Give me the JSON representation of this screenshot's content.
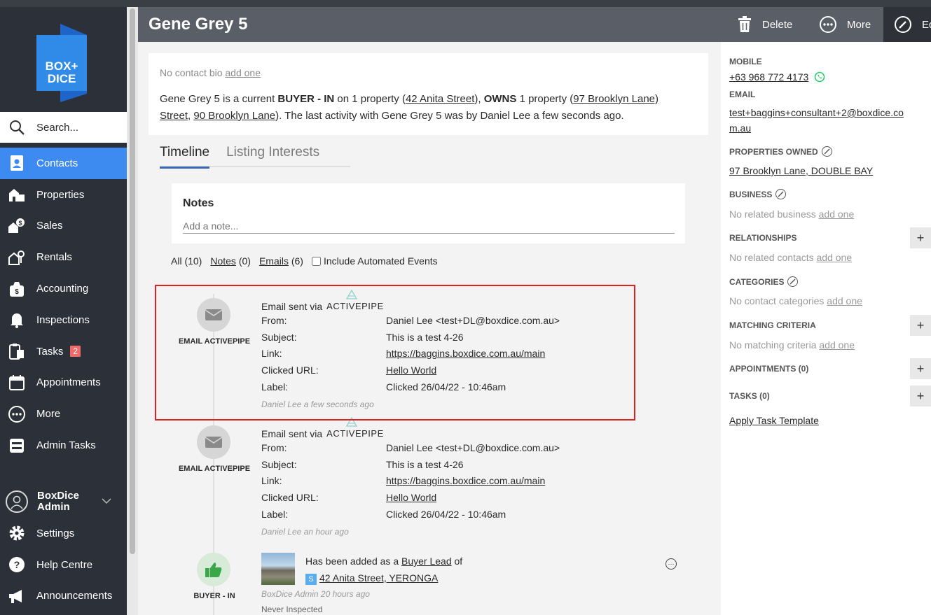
{
  "app": {
    "logo_text": "BOX+DICE"
  },
  "search": {
    "label": "Search..."
  },
  "nav": {
    "items": [
      {
        "label": "Contacts",
        "icon": "contacts-icon",
        "active": true
      },
      {
        "label": "Properties",
        "icon": "properties-icon"
      },
      {
        "label": "Sales",
        "icon": "sales-icon"
      },
      {
        "label": "Rentals",
        "icon": "rentals-icon"
      },
      {
        "label": "Accounting",
        "icon": "accounting-icon"
      },
      {
        "label": "Inspections",
        "icon": "bell-icon"
      },
      {
        "label": "Tasks",
        "icon": "tasks-icon",
        "badge": "2"
      },
      {
        "label": "Appointments",
        "icon": "calendar-icon"
      },
      {
        "label": "More",
        "icon": "more-icon"
      },
      {
        "label": "Admin Tasks",
        "icon": "admin-tasks-icon"
      }
    ],
    "user": {
      "name": "BoxDice Admin"
    },
    "bottom": [
      {
        "label": "Settings",
        "icon": "gear-icon"
      },
      {
        "label": "Help Centre",
        "icon": "help-icon"
      },
      {
        "label": "Announcements",
        "icon": "megaphone-icon"
      }
    ]
  },
  "header": {
    "title": "Gene Grey 5",
    "delete_label": "Delete",
    "more_label": "More",
    "edit_label": "Edit"
  },
  "bio": {
    "none_text": "No contact bio",
    "add_one": "add one",
    "summary": {
      "p1": "Gene Grey 5 is a current ",
      "buyer_status": "BUYER - IN",
      "p2": " on 1 property (",
      "buyer_prop": "42 Anita Street",
      "p3": "), ",
      "owns": "OWNS",
      "p4": " 1 property (",
      "owned_prop1": "97 Brooklyn Lane) Street",
      "p5": ", ",
      "owned_prop2": "90 Brooklyn Lane",
      "p6": "). The last activity with Gene Grey 5 was by Daniel Lee a few seconds ago."
    }
  },
  "tabs": [
    {
      "label": "Timeline"
    },
    {
      "label": "Listing Interests"
    }
  ],
  "notes": {
    "title": "Notes",
    "placeholder": "Add a note..."
  },
  "filters": {
    "all": "All (10)",
    "notes_label": "Notes",
    "notes_count": "(0)",
    "emails_label": "Emails",
    "emails_count": "(6)",
    "automated": "Include Automated Events"
  },
  "timeline": [
    {
      "kind": "EMAIL ACTIVEPIPE",
      "via": "Email sent via",
      "provider": "ACTIVEPIPE",
      "rows": [
        {
          "k": "From:",
          "v": "Daniel Lee <test+DL@boxdice.com.au>"
        },
        {
          "k": "Subject:",
          "v": "This is a test 4-26"
        },
        {
          "k": "Link:",
          "v": "https://baggins.boxdice.com.au/main"
        },
        {
          "k": "Clicked URL:",
          "v": "Hello World"
        },
        {
          "k": "Label:",
          "v": "Clicked 26/04/22 - 10:46am"
        }
      ],
      "meta": "Daniel Lee a few seconds ago"
    },
    {
      "kind": "EMAIL ACTIVEPIPE",
      "via": "Email sent via",
      "provider": "ACTIVEPIPE",
      "rows": [
        {
          "k": "From:",
          "v": "Daniel Lee <test+DL@boxdice.com.au>"
        },
        {
          "k": "Subject:",
          "v": "This is a test 4-26"
        },
        {
          "k": "Link:",
          "v": "https://baggins.boxdice.com.au/main"
        },
        {
          "k": "Clicked URL:",
          "v": "Hello World"
        },
        {
          "k": "Label:",
          "v": "Clicked 26/04/22 - 10:46am"
        }
      ],
      "meta": "Daniel Lee an hour ago"
    },
    {
      "kind": "BUYER - IN",
      "text1": "Has been added as a",
      "lead": "Buyer Lead",
      "text2": "of",
      "s_badge": "S",
      "property": "42 Anita Street, YERONGA",
      "meta": "BoxDice Admin 20 hours ago",
      "extra": "Never Inspected"
    }
  ],
  "right": {
    "mobile_label": "MOBILE",
    "mobile": "+63 968 772 4173",
    "email_label": "EMAIL",
    "email_line1": "test+baggins+consultant+2@boxdice.co",
    "email_line2": "m.au",
    "props_owned_label": "PROPERTIES OWNED",
    "props_owned": "97 Brooklyn Lane, DOUBLE BAY",
    "business_label": "BUSINESS",
    "business_none": "No related business",
    "relationships_label": "RELATIONSHIPS",
    "relationships_none": "No related contacts",
    "categories_label": "CATEGORIES",
    "categories_none": "No contact categories",
    "matching_label": "MATCHING CRITERIA",
    "matching_none": "No matching criteria",
    "appointments_label": "APPOINTMENTS (0)",
    "tasks_label": "TASKS (0)",
    "apply_template": "Apply Task Template",
    "add_one": "add one"
  },
  "colors": {
    "accent": "#3d8bf0",
    "sidebar": "#2c3039",
    "header": "#5a5e66",
    "highlight": "#e02020",
    "whatsapp": "#25d366"
  }
}
